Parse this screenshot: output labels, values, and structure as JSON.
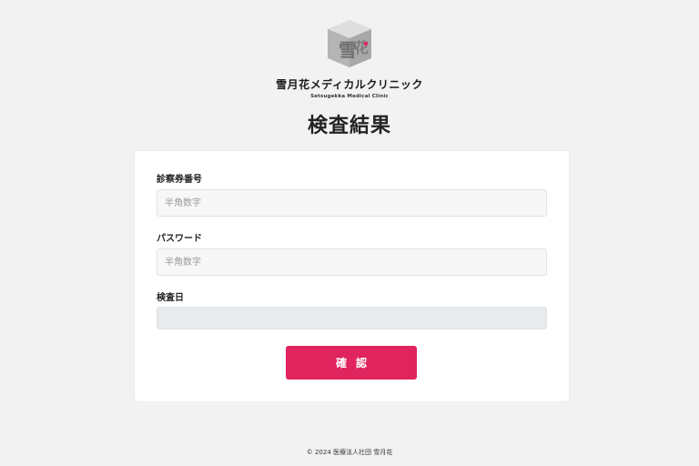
{
  "brand": {
    "logo_kanji_top": "雪",
    "logo_kanji_right": "花",
    "name": "雪月花メディカルクリニック",
    "subtitle": "Setsugekka Medical Clinic",
    "colors": {
      "accent": "#e0245e",
      "logo_gray": "#8c8c8c"
    }
  },
  "page": {
    "title": "検査結果"
  },
  "form": {
    "patient_id": {
      "label": "診察券番号",
      "placeholder": "半角数字",
      "value": ""
    },
    "password": {
      "label": "パスワード",
      "placeholder": "半角数字",
      "value": ""
    },
    "exam_date": {
      "label": "検査日",
      "value": ""
    },
    "submit_label": "確認"
  },
  "footer": {
    "copyright": "© 2024 医療法人社団 雪月花"
  }
}
